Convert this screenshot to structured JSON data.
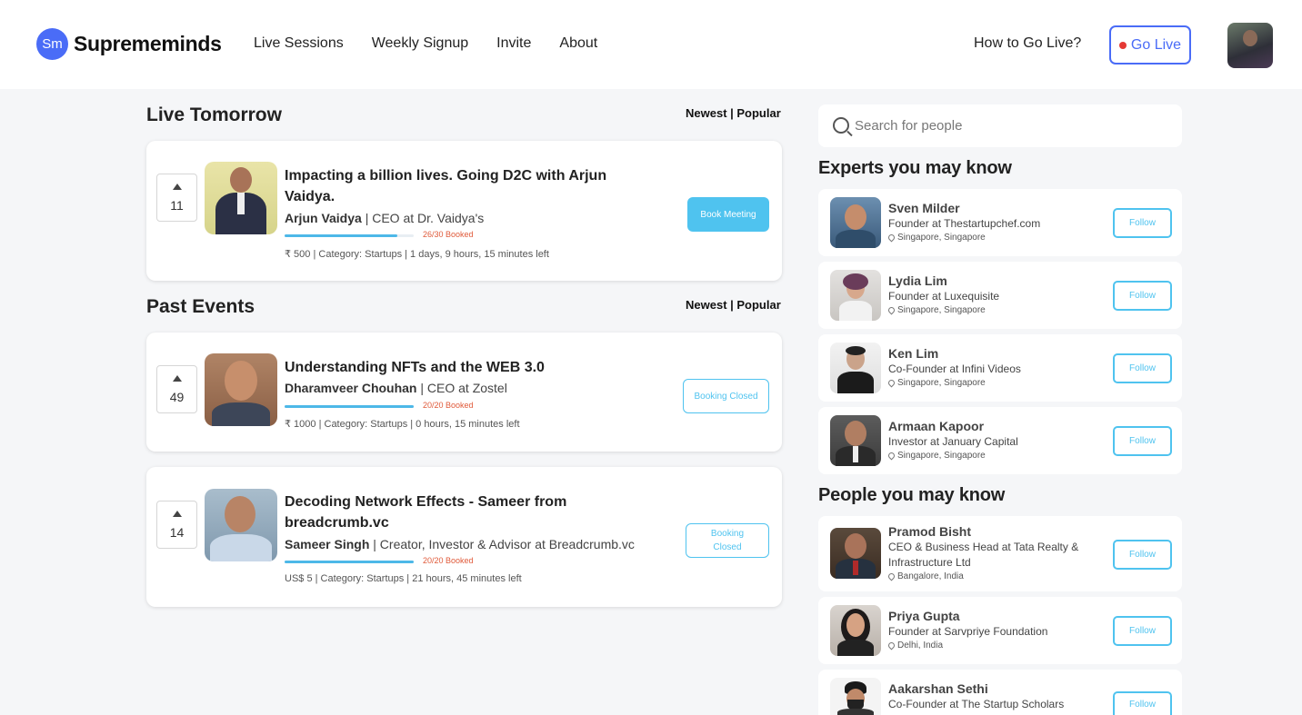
{
  "header": {
    "logo_badge": "Sm",
    "logo_text": "Suprememinds",
    "nav": [
      "Live Sessions",
      "Weekly Signup",
      "Invite",
      "About"
    ],
    "how_to": "How to Go Live?",
    "go_live": "Go Live"
  },
  "live": {
    "title": "Live Tomorrow",
    "sort": "Newest | Popular",
    "events": [
      {
        "votes": "11",
        "title_line1": "Impacting a billion lives. Going D2C with Arjun",
        "title_line2": "Vaidya.",
        "host": "Arjun Vaidya",
        "role": "| CEO at Dr. Vaidya's",
        "booked": "26/30 Booked",
        "booked_fraction": 0.87,
        "meta": "₹ 500 | Category: Startups | 1 days, 9 hours, 15 minutes left",
        "button": "Book Meeting"
      }
    ]
  },
  "past": {
    "title": "Past Events",
    "sort": "Newest | Popular",
    "events": [
      {
        "votes": "49",
        "title_line1": "Understanding NFTs and the WEB 3.0",
        "host": "Dharamveer Chouhan",
        "role": "| CEO at Zostel",
        "booked": "20/20 Booked",
        "booked_fraction": 1.0,
        "meta": "₹ 1000 | Category: Startups | 0 hours, 15 minutes left",
        "button": "Booking Closed"
      },
      {
        "votes": "14",
        "title_line1": "Decoding Network Effects - Sameer from",
        "title_line2": "breadcrumb.vc",
        "host": "Sameer Singh",
        "role": "| Creator, Investor & Advisor at Breadcrumb.vc",
        "booked": "20/20 Booked",
        "booked_fraction": 1.0,
        "meta": "US$ 5 | Category: Startups | 21 hours, 45 minutes left",
        "button_line1": "Booking",
        "button_line2": "Closed"
      }
    ]
  },
  "search": {
    "placeholder": "Search for people"
  },
  "experts": {
    "title": "Experts you may know",
    "people": [
      {
        "name": "Sven Milder",
        "role": "Founder at Thestartupchef.com",
        "location": "Singapore, Singapore",
        "button": "Follow"
      },
      {
        "name": "Lydia Lim",
        "role": "Founder at Luxequisite",
        "location": "Singapore, Singapore",
        "button": "Follow"
      },
      {
        "name": "Ken Lim",
        "role": "Co-Founder at Infini Videos",
        "location": "Singapore, Singapore",
        "button": "Follow"
      },
      {
        "name": "Armaan Kapoor",
        "role": "Investor at January Capital",
        "location": "Singapore, Singapore",
        "button": "Follow"
      }
    ]
  },
  "people": {
    "title": "People you may know",
    "people": [
      {
        "name": "Pramod Bisht",
        "role": "CEO & Business Head at Tata Realty & Infrastructure Ltd",
        "location": "Bangalore, India",
        "button": "Follow"
      },
      {
        "name": "Priya Gupta",
        "role": "Founder at Sarvpriye Foundation",
        "location": "Delhi, India",
        "button": "Follow"
      },
      {
        "name": "Aakarshan Sethi",
        "role": "Co-Founder at The Startup Scholars",
        "button": "Follow"
      }
    ]
  }
}
